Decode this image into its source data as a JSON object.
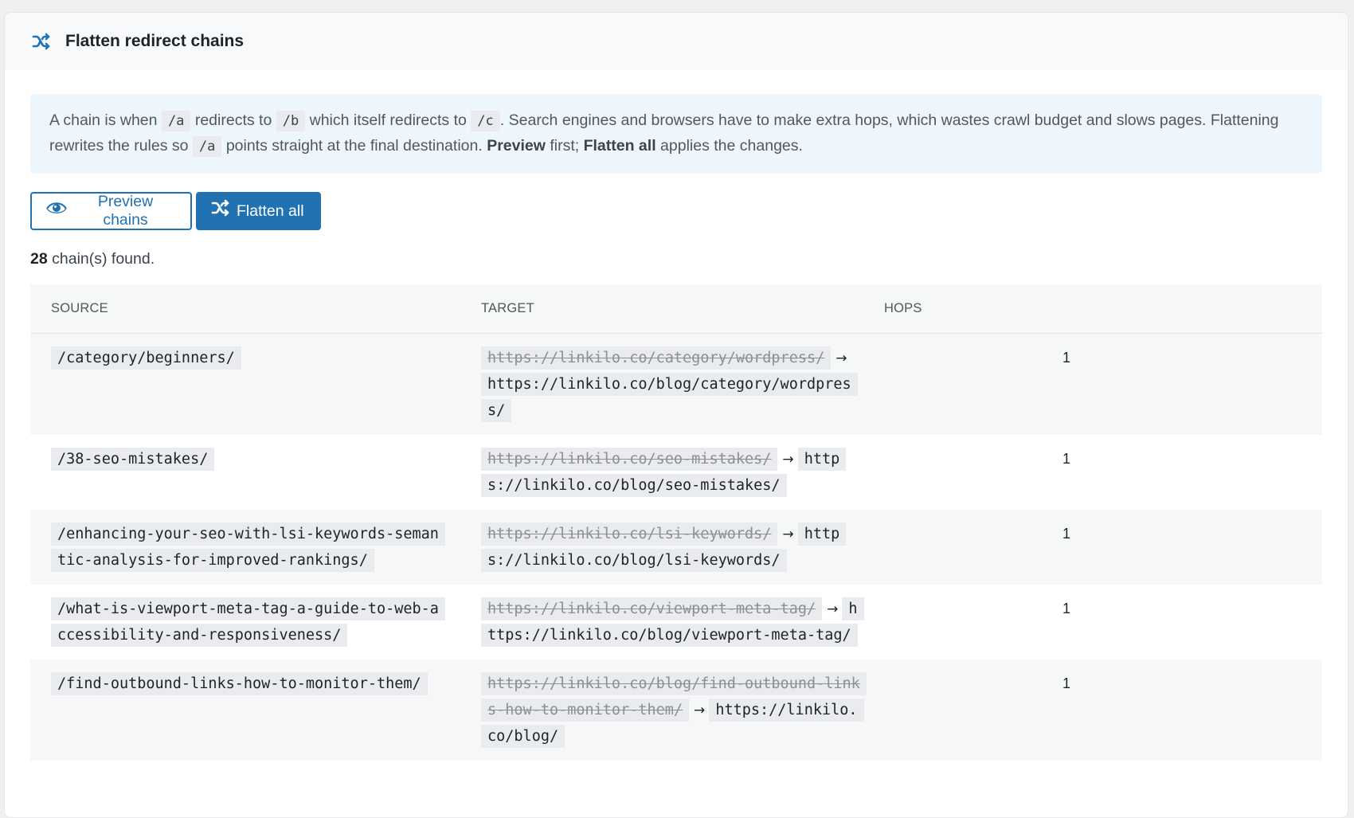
{
  "header": {
    "title": "Flatten redirect chains",
    "icon": "shuffle-icon"
  },
  "notice": {
    "p1": "A chain is when",
    "code_a": "/a",
    "p2": "redirects to",
    "code_b": "/b",
    "p3": "which itself redirects to",
    "code_c": "/c",
    "p4": ". Search engines and browsers have to make extra hops, which wastes crawl budget and slows pages. Flattening rewrites the rules so",
    "code_a2": "/a",
    "p5": "points straight at the final destination.",
    "preview_word": "Preview",
    "p6": "first;",
    "flatten_word": "Flatten all",
    "p7": "applies the changes."
  },
  "actions": {
    "preview_label": "Preview chains",
    "preview_icon": "eye-icon",
    "flatten_label": "Flatten all",
    "flatten_icon": "shuffle-icon"
  },
  "summary": {
    "count": "28",
    "text": "chain(s) found."
  },
  "table": {
    "columns": [
      "SOURCE",
      "TARGET",
      "HOPS"
    ],
    "rows": [
      {
        "source": "/category/beginners/",
        "old_target": "https://linkilo.co/category/wordpress/",
        "new_target": "https://linkilo.co/blog/category/wordpress/",
        "hops": "1"
      },
      {
        "source": "/38-seo-mistakes/",
        "old_target": "https://linkilo.co/seo-mistakes/",
        "new_target": "https://linkilo.co/blog/seo-mistakes/",
        "hops": "1"
      },
      {
        "source": "/enhancing-your-seo-with-lsi-keywords-semantic-analysis-for-improved-rankings/",
        "old_target": "https://linkilo.co/lsi-keywords/",
        "new_target": "https://linkilo.co/blog/lsi-keywords/",
        "hops": "1"
      },
      {
        "source": "/what-is-viewport-meta-tag-a-guide-to-web-accessibility-and-responsiveness/",
        "old_target": "https://linkilo.co/viewport-meta-tag/",
        "new_target": "https://linkilo.co/blog/viewport-meta-tag/",
        "hops": "1"
      },
      {
        "source": "/find-outbound-links-how-to-monitor-them/",
        "old_target": "https://linkilo.co/blog/find-outbound-links-how-to-monitor-them/",
        "new_target": "https://linkilo.co/blog/",
        "hops": "1"
      }
    ]
  },
  "colors": {
    "accent": "#2271b1",
    "notice_bg": "#eef6fd",
    "code_bg": "#e9ebee",
    "row_alt_bg": "#f6f7f7"
  }
}
